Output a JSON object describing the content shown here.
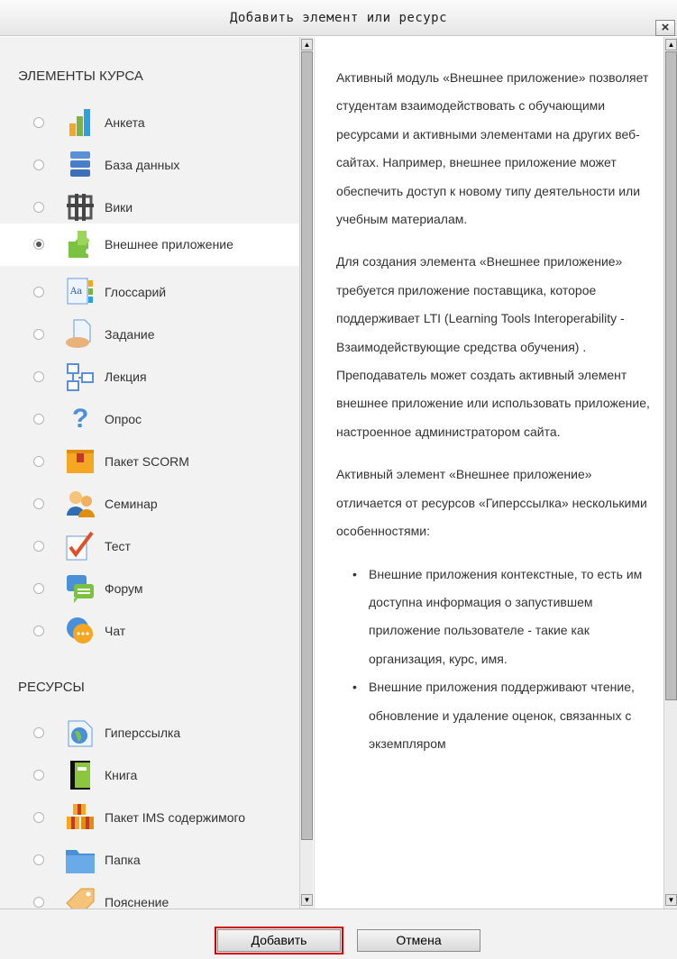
{
  "dialog": {
    "title": "Добавить элемент или ресурс",
    "close_label": "×"
  },
  "sections": {
    "activities_header": "ЭЛЕМЕНТЫ КУРСА",
    "resources_header": "РЕСУРСЫ"
  },
  "activities": [
    {
      "label": "Анкета",
      "icon": "feedback-icon",
      "selected": false
    },
    {
      "label": "База данных",
      "icon": "database-icon",
      "selected": false
    },
    {
      "label": "Вики",
      "icon": "wiki-icon",
      "selected": false
    },
    {
      "label": "Внешнее приложение",
      "icon": "external-tool-icon",
      "selected": true
    },
    {
      "label": "Глоссарий",
      "icon": "glossary-icon",
      "selected": false
    },
    {
      "label": "Задание",
      "icon": "assignment-icon",
      "selected": false
    },
    {
      "label": "Лекция",
      "icon": "lesson-icon",
      "selected": false
    },
    {
      "label": "Опрос",
      "icon": "choice-icon",
      "selected": false
    },
    {
      "label": "Пакет SCORM",
      "icon": "scorm-icon",
      "selected": false
    },
    {
      "label": "Семинар",
      "icon": "workshop-icon",
      "selected": false
    },
    {
      "label": "Тест",
      "icon": "quiz-icon",
      "selected": false
    },
    {
      "label": "Форум",
      "icon": "forum-icon",
      "selected": false
    },
    {
      "label": "Чат",
      "icon": "chat-icon",
      "selected": false
    }
  ],
  "resources": [
    {
      "label": "Гиперссылка",
      "icon": "url-icon",
      "selected": false
    },
    {
      "label": "Книга",
      "icon": "book-icon",
      "selected": false
    },
    {
      "label": "Пакет IMS содержимого",
      "icon": "ims-package-icon",
      "selected": false
    },
    {
      "label": "Папка",
      "icon": "folder-icon",
      "selected": false
    },
    {
      "label": "Пояснение",
      "icon": "label-icon",
      "selected": false
    }
  ],
  "description": {
    "p1": "Активный модуль «Внешнее приложение» позволяет студентам взаимодействовать с обучающими ресурсами и активными элементами на других веб-сайтах. Например, внешнее приложение может обеспечить доступ к новому типу деятельности или учебным материалам.",
    "p2": "Для создания элемента «Внешнее приложение» требуется приложение поставщика, которое поддерживает LTI (Learning Tools Interoperability - Взаимодействующие средства обучения) . Преподаватель может создать активный элемент внешнее приложение или использовать приложение, настроенное администратором сайта.",
    "p3": "Активный элемент «Внешнее приложение» отличается от ресурсов «Гиперссылка» несколькими особенностями:",
    "bullets": [
      "Внешние приложения контекстные, то есть им доступна информация о запустившем приложение пользователе - такие как организация, курс, имя.",
      "Внешние приложения поддерживают чтение, обновление и удаление оценок, связанных с экземпляром"
    ]
  },
  "footer": {
    "add_label": "Добавить",
    "cancel_label": "Отмена"
  },
  "colors": {
    "highlight_outline": "#d40000",
    "panel_bg": "#f2f2f2",
    "selected_bg": "#ffffff"
  }
}
